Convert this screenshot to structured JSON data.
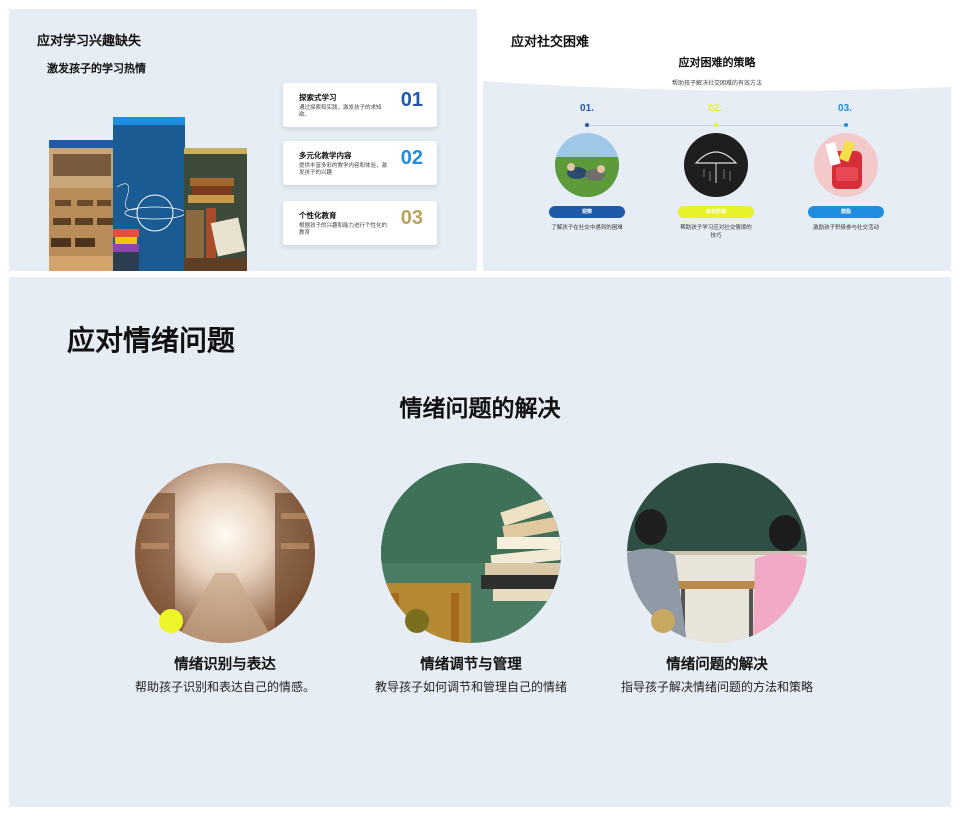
{
  "slide1": {
    "title": "应对学习兴趣缺失",
    "subtitle": "激发孩子的学习热情",
    "cards": [
      {
        "title": "探索式学习",
        "desc": "通过探索和实践，激发孩子的求知欲。",
        "num": "01",
        "color": "#1e5aa8"
      },
      {
        "title": "多元化教学内容",
        "desc": "提供丰富多彩的教学内容和体验，激发孩子的兴趣",
        "num": "02",
        "color": "#1f8de0"
      },
      {
        "title": "个性化教育",
        "desc": "根据孩子的兴趣和能力进行个性化的教育",
        "num": "03",
        "color": "#b8a45a"
      }
    ],
    "photo_sign_text": "EDUCATION IS POWER!"
  },
  "slide2": {
    "title": "应对社交困难",
    "subtitle": "应对困难的策略",
    "desc": "帮助孩子解决社交困难的有效方法",
    "steps": [
      {
        "num": "01.",
        "label": "观察",
        "text": "了解孩子在社交中遇到的困难",
        "color": "#1e5aa8"
      },
      {
        "num": "02.",
        "label": "角色扮演",
        "text": "帮助孩子学习应对社交情境的技巧",
        "color": "#e8f22a"
      },
      {
        "num": "03.",
        "label": "鼓励",
        "text": "激励孩子积极参与社交活动",
        "color": "#1f8de0"
      }
    ]
  },
  "slide3": {
    "title": "应对情绪问题",
    "subtitle": "情绪问题的解决",
    "items": [
      {
        "title": "情绪识别与表达",
        "desc": "帮助孩子识别和表达自己的情感。",
        "accent": "#eef52a"
      },
      {
        "title": "情绪调节与管理",
        "desc": "教导孩子如何调节和管理自己的情绪",
        "accent": "#7a6f1c"
      },
      {
        "title": "情绪问题的解决",
        "desc": "指导孩子解决情绪问题的方法和策略",
        "accent": "#c8a85e"
      }
    ]
  }
}
